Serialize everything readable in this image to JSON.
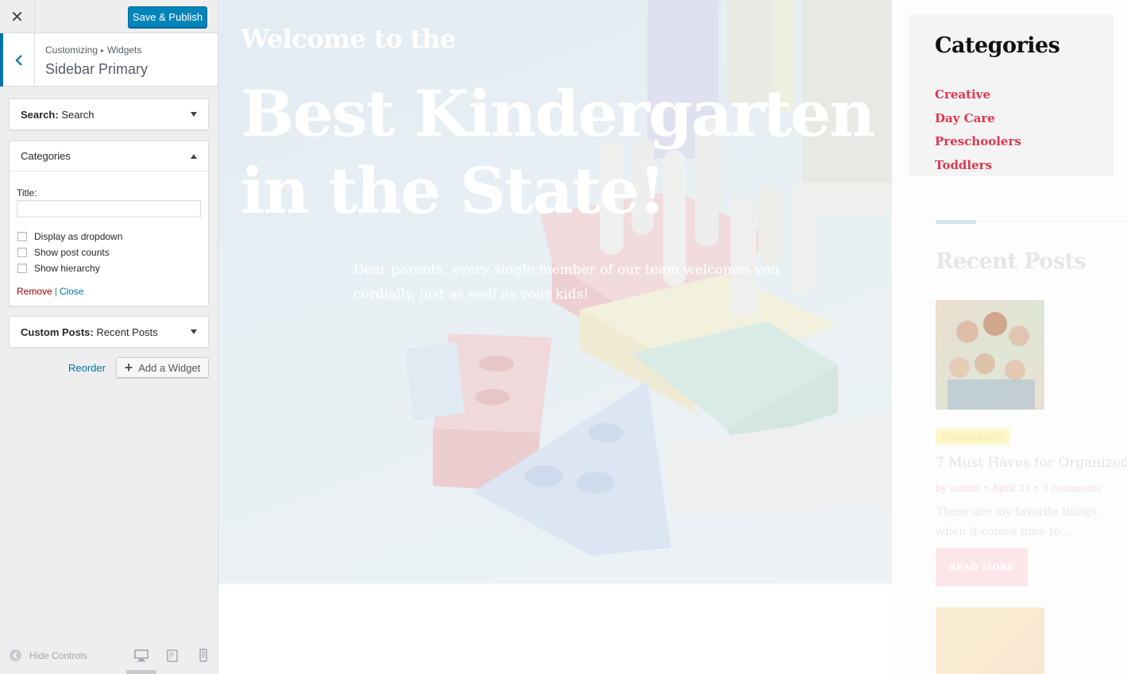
{
  "customizer": {
    "close_glyph": "✕",
    "publish_label": "Save & Publish",
    "breadcrumb": {
      "root": "Customizing",
      "separator": "▸",
      "current": "Widgets"
    },
    "section_title": "Sidebar Primary",
    "widgets": {
      "search": {
        "type": "Search:",
        "name": "Search"
      },
      "categories": {
        "title": "Categories",
        "title_label": "Title:",
        "title_value": "",
        "options": [
          {
            "label": "Display as dropdown",
            "checked": false
          },
          {
            "label": "Show post counts",
            "checked": false
          },
          {
            "label": "Show hierarchy",
            "checked": false
          }
        ],
        "remove_label": "Remove",
        "separator": "|",
        "close_label": "Close"
      },
      "recent": {
        "type": "Custom Posts:",
        "name": "Recent Posts"
      }
    },
    "reorder_label": "Reorder",
    "add_widget_label": "Add a Widget",
    "add_widget_glyph": "+",
    "hide_controls_label": "Hide Controls"
  },
  "preview": {
    "hero": {
      "subtitle": "Welcome to the",
      "title": "Best Kindergarten in the State!",
      "text": "Dear parents, every single member of our team welcomes you cordially, just as well as your kids!"
    },
    "sidebar": {
      "categories_heading": "Categories",
      "categories": [
        "Creative",
        "Day Care",
        "Preschoolers",
        "Toddlers"
      ],
      "recent_heading": "Recent Posts",
      "post": {
        "category": "Preschoolers",
        "title": "7 Must Haves for Organized",
        "meta": "by admin  •  April 21  •  0 comments",
        "excerpt": "These are my favorite things when it comes time to...",
        "read_more": "READ MORE"
      }
    }
  },
  "colors": {
    "accent": "#0085ba",
    "link": "#0073aa",
    "remove": "#a00000",
    "category_link": "#e2364f"
  }
}
